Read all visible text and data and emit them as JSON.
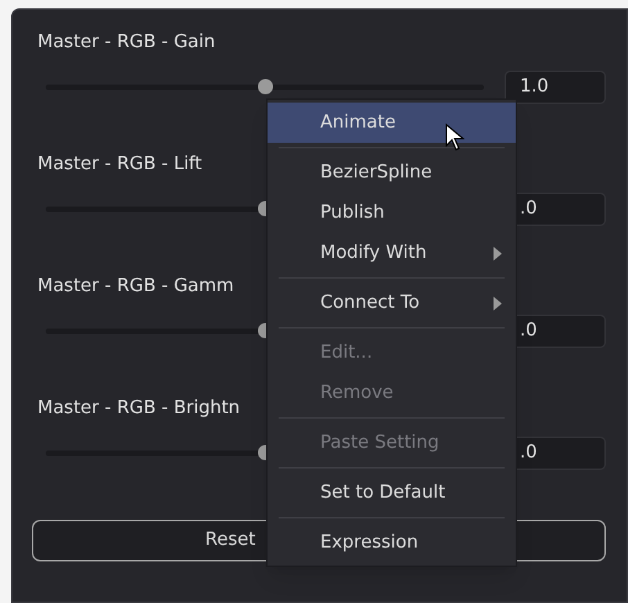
{
  "sliders": [
    {
      "label": "Master - RGB - Gain",
      "level": 0.5,
      "value": "1.0"
    },
    {
      "label": "Master - RGB - Lift",
      "level": 0.5,
      "value": ".0"
    },
    {
      "label": "Master - RGB - Gamm",
      "level": 0.5,
      "value": ".0"
    },
    {
      "label": "Master - RGB - Brightn",
      "level": 0.5,
      "value": ".0"
    }
  ],
  "reset_button": "Reset",
  "context_menu": [
    {
      "kind": "item",
      "label": "Animate",
      "selected": true,
      "disabled": false,
      "submenu": false
    },
    {
      "kind": "separator"
    },
    {
      "kind": "item",
      "label": "BezierSpline",
      "selected": false,
      "disabled": false,
      "submenu": false
    },
    {
      "kind": "item",
      "label": "Publish",
      "selected": false,
      "disabled": false,
      "submenu": false
    },
    {
      "kind": "item",
      "label": "Modify With",
      "selected": false,
      "disabled": false,
      "submenu": true
    },
    {
      "kind": "separator"
    },
    {
      "kind": "item",
      "label": "Connect To",
      "selected": false,
      "disabled": false,
      "submenu": true
    },
    {
      "kind": "separator"
    },
    {
      "kind": "item",
      "label": "Edit...",
      "selected": false,
      "disabled": true,
      "submenu": false
    },
    {
      "kind": "item",
      "label": "Remove",
      "selected": false,
      "disabled": true,
      "submenu": false
    },
    {
      "kind": "separator"
    },
    {
      "kind": "item",
      "label": "Paste Setting",
      "selected": false,
      "disabled": true,
      "submenu": false
    },
    {
      "kind": "separator"
    },
    {
      "kind": "item",
      "label": "Set to Default",
      "selected": false,
      "disabled": false,
      "submenu": false
    },
    {
      "kind": "separator"
    },
    {
      "kind": "item",
      "label": "Expression",
      "selected": false,
      "disabled": false,
      "submenu": false
    }
  ]
}
